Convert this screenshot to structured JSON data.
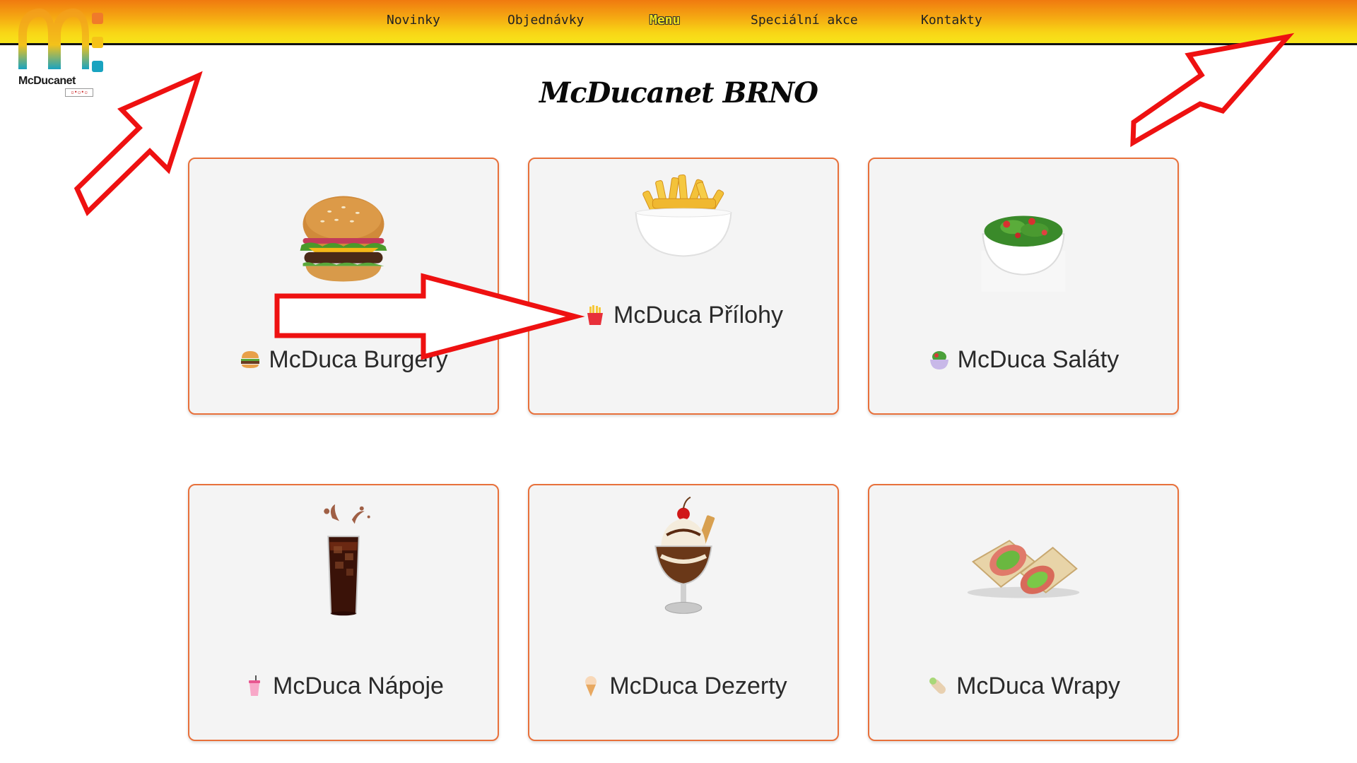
{
  "brand": {
    "name": "McDucanet",
    "badge": "▫•▫•▫"
  },
  "nav": {
    "items": [
      {
        "label": "Novinky",
        "active": false
      },
      {
        "label": "Objednávky",
        "active": false
      },
      {
        "label": "Menu",
        "active": true
      },
      {
        "label": "Speciální akce",
        "active": false
      },
      {
        "label": "Kontakty",
        "active": false
      }
    ]
  },
  "page": {
    "title": "McDucanet BRNO"
  },
  "cards": [
    {
      "label": "McDuca Burgery",
      "icon": "burger-icon"
    },
    {
      "label": "McDuca Přílohy",
      "icon": "fries-icon"
    },
    {
      "label": "McDuca Saláty",
      "icon": "salad-icon"
    },
    {
      "label": "McDuca Nápoje",
      "icon": "drink-icon"
    },
    {
      "label": "McDuca Dezerty",
      "icon": "ice-cream-icon"
    },
    {
      "label": "McDuca Wrapy",
      "icon": "wrap-icon"
    }
  ],
  "colors": {
    "header_top": "#f07a0f",
    "header_bottom": "#f7e51a",
    "card_border": "#e8703a",
    "card_bg": "#f4f4f4",
    "annotation_arrow": "#ee1111"
  }
}
